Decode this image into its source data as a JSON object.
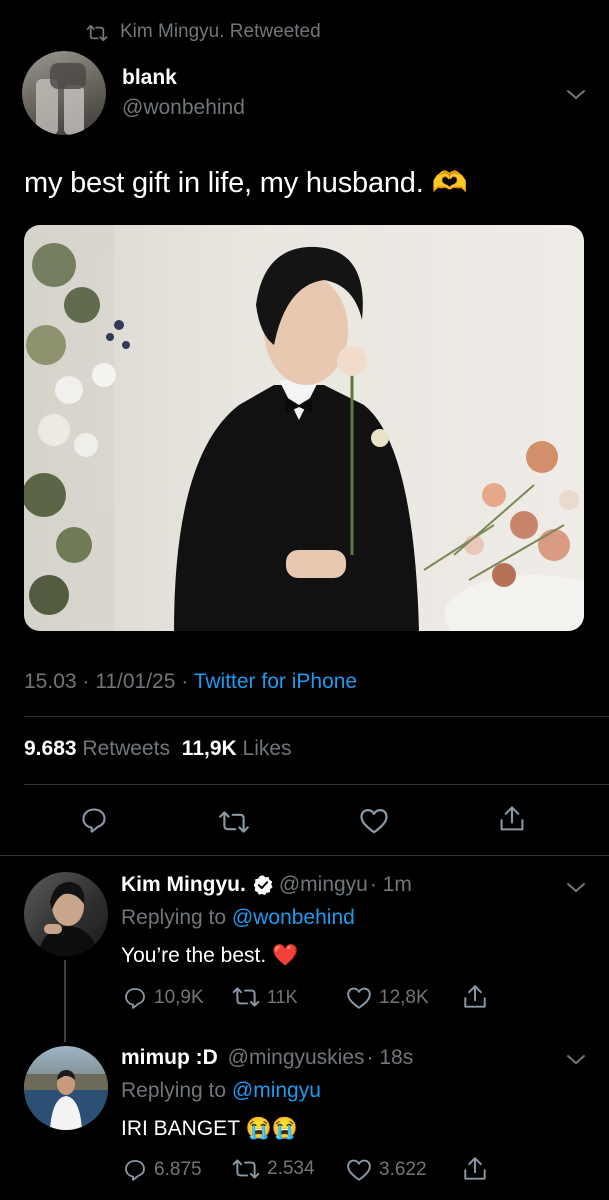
{
  "retweet_banner": {
    "text": "Kim Mingyu. Retweeted"
  },
  "main_tweet": {
    "display_name": "blank",
    "handle": "@wonbehind",
    "text": "my best gift in life, my husband.",
    "emoji": "🫶",
    "time": "15.03 · 11/01/25 ·",
    "source": "Twitter for iPhone",
    "retweets_count": "9.683",
    "retweets_label": "Retweets",
    "likes_count": "11,9K",
    "likes_label": "Likes"
  },
  "replies": [
    {
      "display_name": "Kim Mingyu.",
      "handle": "@mingyu",
      "time": "· 1m",
      "replying_label": "Replying to",
      "replying_to": "@wonbehind",
      "text": "You’re the best.",
      "emoji": "❤️",
      "reply_count": "10,9K",
      "retweet_count": "11K",
      "like_count": "12,8K",
      "verified": true
    },
    {
      "display_name": "mimup :D",
      "handle": "@mingyuskies",
      "time": "· 18s",
      "replying_label": "Replying to",
      "replying_to": "@mingyu",
      "text": "IRI BANGET",
      "emoji": "😭😭",
      "reply_count": "6.875",
      "retweet_count": "2.534",
      "like_count": "3.622",
      "verified": false
    }
  ],
  "colors": {
    "accent": "#1d9bf0",
    "muted": "#71767b",
    "background": "#000000",
    "heart": "#e0245e"
  }
}
